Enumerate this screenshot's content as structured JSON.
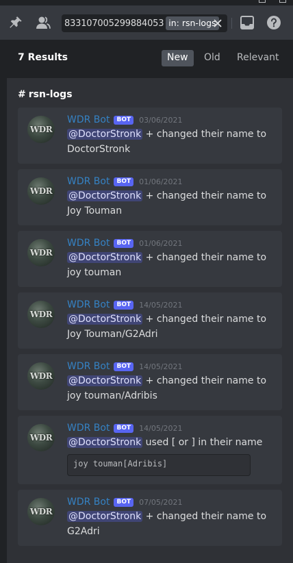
{
  "toolbar": {
    "search_query": "833107005299884053",
    "search_filter": "in: rsn-logs"
  },
  "results": {
    "count_label": "7 Results",
    "sort_tabs": [
      {
        "label": "New",
        "active": true
      },
      {
        "label": "Old",
        "active": false
      },
      {
        "label": "Relevant",
        "active": false
      }
    ]
  },
  "channel": {
    "hash": "#",
    "name": "rsn-logs"
  },
  "messages": [
    {
      "author": "WDR Bot",
      "tag": "BOT",
      "timestamp": "03/06/2021",
      "avatar_text": "WDR",
      "mention": "@DoctorStronk",
      "text_a": " + changed their name to",
      "text_b": "DoctorStronk"
    },
    {
      "author": "WDR Bot",
      "tag": "BOT",
      "timestamp": "01/06/2021",
      "avatar_text": "WDR",
      "mention": "@DoctorStronk",
      "text_a": " + changed their name to",
      "text_b": "Joy Touman"
    },
    {
      "author": "WDR Bot",
      "tag": "BOT",
      "timestamp": "01/06/2021",
      "avatar_text": "WDR",
      "mention": "@DoctorStronk",
      "text_a": " + changed their name to",
      "text_b": "joy touman"
    },
    {
      "author": "WDR Bot",
      "tag": "BOT",
      "timestamp": "14/05/2021",
      "avatar_text": "WDR",
      "mention": "@DoctorStronk",
      "text_a": " + changed their name to",
      "text_b": "Joy Touman/G2Adri"
    },
    {
      "author": "WDR Bot",
      "tag": "BOT",
      "timestamp": "14/05/2021",
      "avatar_text": "WDR",
      "mention": "@DoctorStronk",
      "text_a": " + changed their name to",
      "text_b": "joy touman/Adribis"
    },
    {
      "author": "WDR Bot",
      "tag": "BOT",
      "timestamp": "14/05/2021",
      "avatar_text": "WDR",
      "mention": "@DoctorStronk",
      "text_a": " used [ or ] in their name",
      "code": "joy touman[Adribis]"
    },
    {
      "author": "WDR Bot",
      "tag": "BOT",
      "timestamp": "07/05/2021",
      "avatar_text": "WDR",
      "mention": "@DoctorStronk",
      "text_a": " + changed their name to",
      "text_b": "G2Adri"
    }
  ],
  "icons": {
    "pin": "pin-icon",
    "members": "members-icon",
    "clear": "close-icon",
    "inbox": "inbox-icon",
    "help": "help-icon"
  },
  "colors": {
    "author": "#3582c4",
    "bot_tag": "#5865f2",
    "mention_bg": "#414675",
    "panel_bg": "#2f3136",
    "card_bg": "#36393f"
  }
}
